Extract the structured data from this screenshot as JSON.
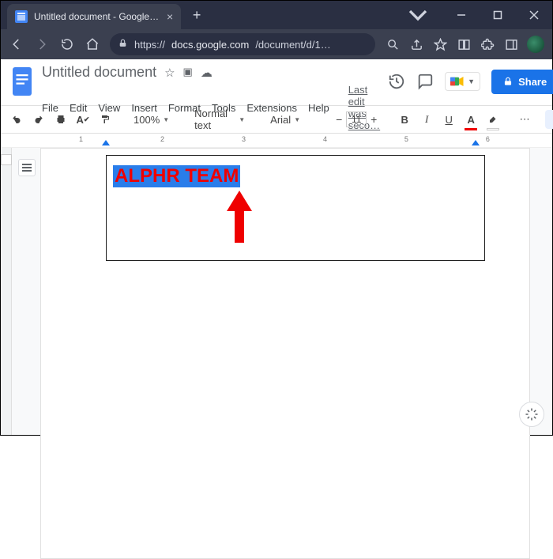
{
  "browser": {
    "tab_title": "Untitled document - Google Docs",
    "url_scheme": "https://",
    "url_host": "docs.google.com",
    "url_path": "/document/d/1…"
  },
  "docs": {
    "title": "Untitled document",
    "menus": [
      "File",
      "Edit",
      "View",
      "Insert",
      "Format",
      "Tools",
      "Extensions",
      "Help"
    ],
    "last_edit": "Last edit was seco…",
    "share_label": "Share"
  },
  "toolbar": {
    "zoom": "100%",
    "style": "Normal text",
    "font": "Arial",
    "font_size": "11"
  },
  "ruler": {
    "marks": [
      "",
      "1",
      "",
      "2",
      "",
      "3",
      "",
      "4",
      "",
      "5",
      "",
      "6",
      ""
    ]
  },
  "document": {
    "selected_text": "ALPHR TEAM"
  }
}
